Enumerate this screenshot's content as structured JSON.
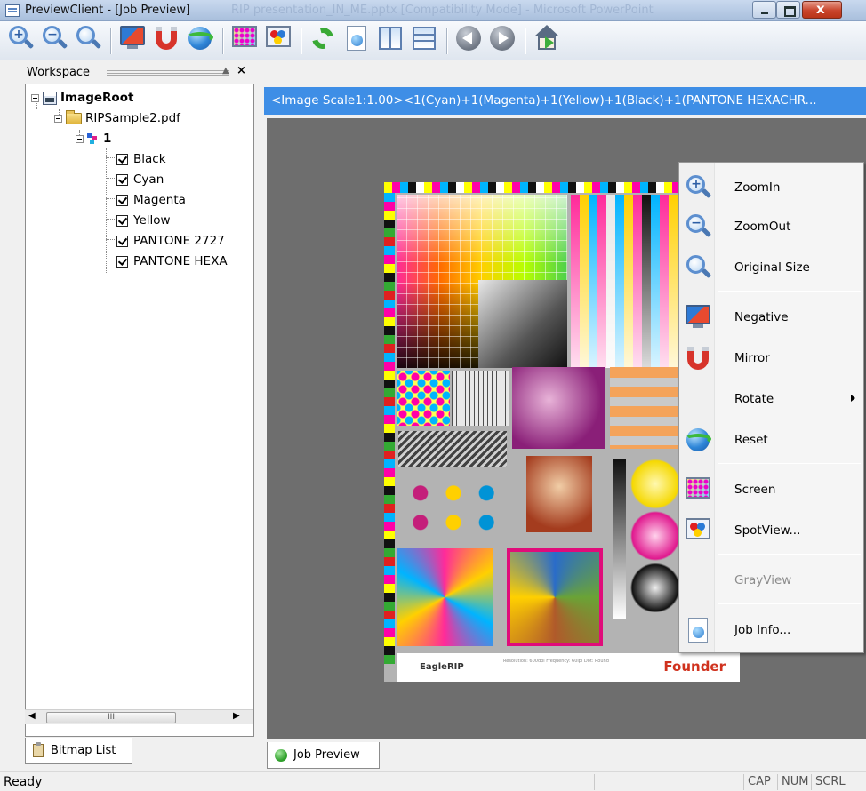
{
  "window": {
    "title": "PreviewClient - [Job Preview]",
    "background_title": "RIP presentation_IN_ME.pptx [Compatibility Mode] - Microsoft PowerPoint",
    "controls": [
      "minimize",
      "maximize",
      "close"
    ]
  },
  "toolbar": {
    "buttons": [
      {
        "name": "zoom-in",
        "icon": "zoom-in-icon"
      },
      {
        "name": "zoom-out",
        "icon": "zoom-out-icon"
      },
      {
        "name": "original-size",
        "icon": "magnifier-icon"
      },
      {
        "name": "negative",
        "icon": "negative-monitor-icon"
      },
      {
        "name": "mirror",
        "icon": "magnet-mirror-icon"
      },
      {
        "name": "reset",
        "icon": "reset-globe-icon"
      },
      {
        "name": "screen",
        "icon": "screen-icon"
      },
      {
        "name": "spotview",
        "icon": "spotview-icon"
      },
      {
        "name": "refresh",
        "icon": "refresh-icon"
      },
      {
        "name": "job-info",
        "icon": "document-globe-icon"
      },
      {
        "name": "split-vertical",
        "icon": "split-vertical-icon"
      },
      {
        "name": "split-horizontal",
        "icon": "split-horizontal-icon"
      },
      {
        "name": "previous",
        "icon": "arrow-left-icon"
      },
      {
        "name": "next",
        "icon": "arrow-right-icon"
      },
      {
        "name": "home",
        "icon": "home-icon"
      }
    ]
  },
  "workspace": {
    "title": "Workspace",
    "pin": "▲",
    "close": "×",
    "tree": {
      "root": "ImageRoot",
      "file": "RIPSample2.pdf",
      "page": "1",
      "separations": [
        "Black",
        "Cyan",
        "Magenta",
        "Yellow",
        "PANTONE 2727",
        "PANTONE HEXA"
      ]
    },
    "scroll_thumb": "III",
    "bottom_tab": "Bitmap List"
  },
  "document": {
    "header": "<Image Scale1:1.00><1(Cyan)+1(Magenta)+1(Yellow)+1(Black)+1(PANTONE HEXACHR...",
    "tab": "Job Preview",
    "sheet_footer": {
      "brand_left": "EagleRIP",
      "brand_right": "Founder",
      "small_text": "Resolution: 600dpi  Frequency: 60lpi  Dot: Round"
    }
  },
  "context_menu": {
    "items": [
      {
        "label": "ZoomIn",
        "icon": "zoom-in-icon",
        "enabled": true
      },
      {
        "label": "ZoomOut",
        "icon": "zoom-out-icon",
        "enabled": true
      },
      {
        "label": "Original Size",
        "icon": "magnifier-icon",
        "enabled": true
      },
      {
        "label": "Negative",
        "icon": "negative-monitor-icon",
        "enabled": true
      },
      {
        "label": "Mirror",
        "icon": "magnet-mirror-icon",
        "enabled": true
      },
      {
        "label": "Rotate",
        "icon": "",
        "enabled": true,
        "submenu": true
      },
      {
        "label": "Reset",
        "icon": "reset-globe-icon",
        "enabled": true
      },
      {
        "label": "Screen",
        "icon": "screen-icon",
        "enabled": true
      },
      {
        "label": "SpotView...",
        "icon": "spotview-icon",
        "enabled": true
      },
      {
        "label": "GrayView",
        "icon": "",
        "enabled": false
      },
      {
        "label": "Job Info...",
        "icon": "document-globe-icon",
        "enabled": true
      }
    ]
  },
  "statusbar": {
    "text": "Ready",
    "indicators": [
      "CAP",
      "NUM",
      "SCRL"
    ]
  },
  "colors": {
    "doc_header_bg": "#3e8ee6",
    "viewport_bg": "#6e6e6e",
    "founder_red": "#d0321e"
  }
}
